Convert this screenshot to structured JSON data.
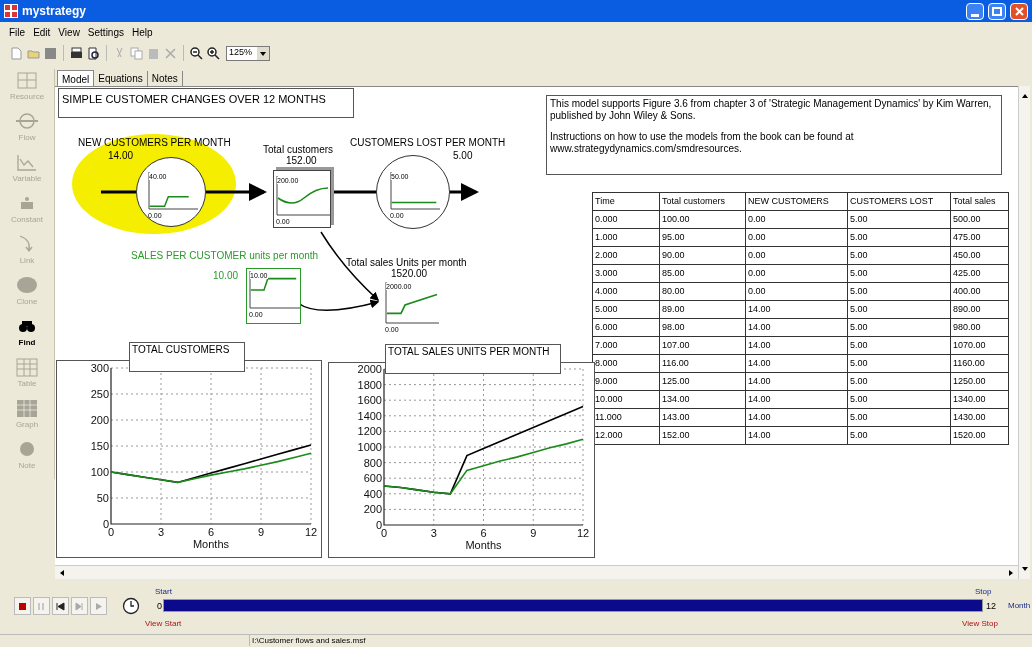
{
  "window": {
    "title": "mystrategy"
  },
  "menu": [
    "File",
    "Edit",
    "View",
    "Settings",
    "Help"
  ],
  "toolbar": {
    "zoom": "125%"
  },
  "palette": [
    {
      "label": "Resource",
      "disabled": true
    },
    {
      "label": "Flow",
      "disabled": true
    },
    {
      "label": "Variable",
      "disabled": true
    },
    {
      "label": "Constant",
      "disabled": true
    },
    {
      "label": "Link",
      "disabled": true
    },
    {
      "label": "Clone",
      "disabled": true
    },
    {
      "label": "Find",
      "disabled": false
    },
    {
      "label": "Table",
      "disabled": true
    },
    {
      "label": "Graph",
      "disabled": true
    },
    {
      "label": "Note",
      "disabled": true
    }
  ],
  "tabs": [
    {
      "label": "Model",
      "selected": true
    },
    {
      "label": "Equations",
      "selected": false
    },
    {
      "label": "Notes",
      "selected": false
    }
  ],
  "model": {
    "title": "SIMPLE CUSTOMER CHANGES OVER 12 MONTHS",
    "note": [
      "This model supports Figure 3.6 from chapter 3 of 'Strategic Management Dynamics' by Kim Warren, published by John Wiley & Sons.",
      "Instructions on how to use the models from the book can be found at www.strategydynamics.com/smdresources."
    ],
    "nodes": [
      {
        "kind": "flow",
        "label": "NEW CUSTOMERS PER MONTH",
        "value": "14.00",
        "axis_max": "40.00",
        "axis_min": "0.00",
        "highlighted": true
      },
      {
        "kind": "stock",
        "label": "Total customers",
        "value": "152.00",
        "axis_max": "200.00",
        "axis_min": "0.00",
        "highlighted": false
      },
      {
        "kind": "flow",
        "label": "CUSTOMERS LOST PER MONTH",
        "value": "5.00",
        "axis_max": "50.00",
        "axis_min": "0.00",
        "highlighted": false
      },
      {
        "kind": "constant",
        "label": "SALES PER CUSTOMER units per month",
        "value": "10.00",
        "axis_max": "10.00",
        "axis_min": "0.00",
        "highlighted": false
      },
      {
        "kind": "variable",
        "label": "Total sales Units per month",
        "value": "1520.00",
        "axis_max": "2000.00",
        "axis_min": "0.00",
        "highlighted": false
      }
    ],
    "table": {
      "columns": [
        "Time",
        "Total customers",
        "NEW CUSTOMERS",
        "CUSTOMERS LOST",
        "Total sales"
      ],
      "rows": [
        [
          "0.000",
          "100.00",
          "0.00",
          "5.00",
          "500.00"
        ],
        [
          "1.000",
          "95.00",
          "0.00",
          "5.00",
          "475.00"
        ],
        [
          "2.000",
          "90.00",
          "0.00",
          "5.00",
          "450.00"
        ],
        [
          "3.000",
          "85.00",
          "0.00",
          "5.00",
          "425.00"
        ],
        [
          "4.000",
          "80.00",
          "0.00",
          "5.00",
          "400.00"
        ],
        [
          "5.000",
          "89.00",
          "14.00",
          "5.00",
          "890.00"
        ],
        [
          "6.000",
          "98.00",
          "14.00",
          "5.00",
          "980.00"
        ],
        [
          "7.000",
          "107.00",
          "14.00",
          "5.00",
          "1070.00"
        ],
        [
          "8.000",
          "116.00",
          "14.00",
          "5.00",
          "1160.00"
        ],
        [
          "9.000",
          "125.00",
          "14.00",
          "5.00",
          "1250.00"
        ],
        [
          "10.000",
          "134.00",
          "14.00",
          "5.00",
          "1340.00"
        ],
        [
          "11.000",
          "143.00",
          "14.00",
          "5.00",
          "1430.00"
        ],
        [
          "12.000",
          "152.00",
          "14.00",
          "5.00",
          "1520.00"
        ]
      ]
    },
    "graphs": [
      {
        "chart_data": {
          "type": "line",
          "grid": true,
          "title": "TOTAL CUSTOMERS",
          "xlabel": "Months",
          "x": [
            0,
            1,
            2,
            3,
            4,
            5,
            6,
            7,
            8,
            9,
            10,
            11,
            12
          ],
          "xlim": [
            0,
            12
          ],
          "ylim": [
            0,
            300
          ],
          "xticks": [
            0,
            3,
            6,
            9,
            12
          ],
          "yticks": [
            0,
            50,
            100,
            150,
            200,
            250,
            300
          ],
          "series": [
            {
              "color": "#000000",
              "values": [
                100,
                95,
                90,
                85,
                80,
                89,
                98,
                107,
                116,
                125,
                134,
                143,
                152
              ]
            },
            {
              "color": "#1a8a1a",
              "values": [
                100,
                95,
                90,
                85,
                80,
                87,
                94,
                100,
                106,
                113,
                120,
                128,
                136
              ]
            }
          ]
        }
      },
      {
        "chart_data": {
          "type": "line",
          "grid": true,
          "title": "TOTAL SALES UNITS PER MONTH",
          "xlabel": "Months",
          "x": [
            0,
            1,
            2,
            3,
            4,
            5,
            6,
            7,
            8,
            9,
            10,
            11,
            12
          ],
          "xlim": [
            0,
            12
          ],
          "ylim": [
            0,
            2000
          ],
          "xticks": [
            0,
            3,
            6,
            9,
            12
          ],
          "yticks": [
            0,
            200,
            400,
            600,
            800,
            1000,
            1200,
            1400,
            1600,
            1800,
            2000
          ],
          "series": [
            {
              "color": "#000000",
              "values": [
                500,
                480,
                450,
                420,
                400,
                890,
                980,
                1070,
                1160,
                1250,
                1340,
                1430,
                1520
              ]
            },
            {
              "color": "#1a8a1a",
              "values": [
                500,
                480,
                450,
                420,
                400,
                700,
                760,
                820,
                870,
                930,
                990,
                1040,
                1100
              ]
            }
          ]
        }
      }
    ]
  },
  "run": {
    "start_label": "Start",
    "start": "0",
    "progress": {
      "level": 1
    },
    "stop": "12",
    "unit": "Month",
    "stop_label": "Stop",
    "view_start": "View Start",
    "view_stop": "View Stop"
  },
  "status_bar": "I:\\Customer flows and sales.msf"
}
